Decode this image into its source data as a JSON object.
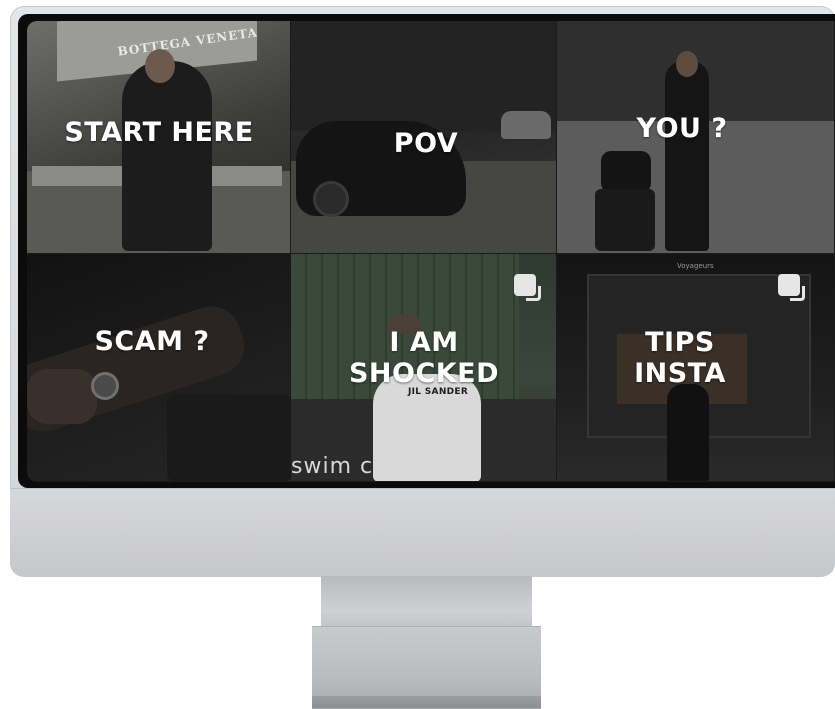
{
  "screen": {
    "tiles": [
      {
        "label": "START HERE",
        "sign": "BOTTEGA VENETA"
      },
      {
        "label": "POV"
      },
      {
        "label": "YOU ?"
      },
      {
        "label": "SCAM ?"
      },
      {
        "label": "I AM\nSHOCKED",
        "shirt_text": "JIL SANDER",
        "wall_text": "swim c"
      },
      {
        "label": "TIPS\nINSTA",
        "store_text": "Voyageurs"
      }
    ]
  },
  "colors": {
    "label_text": "#ffffff",
    "monitor_silver": "#d3d4d7",
    "screen_bezel": "#0b0b0c"
  },
  "icons": [
    "multiple-images-icon"
  ]
}
